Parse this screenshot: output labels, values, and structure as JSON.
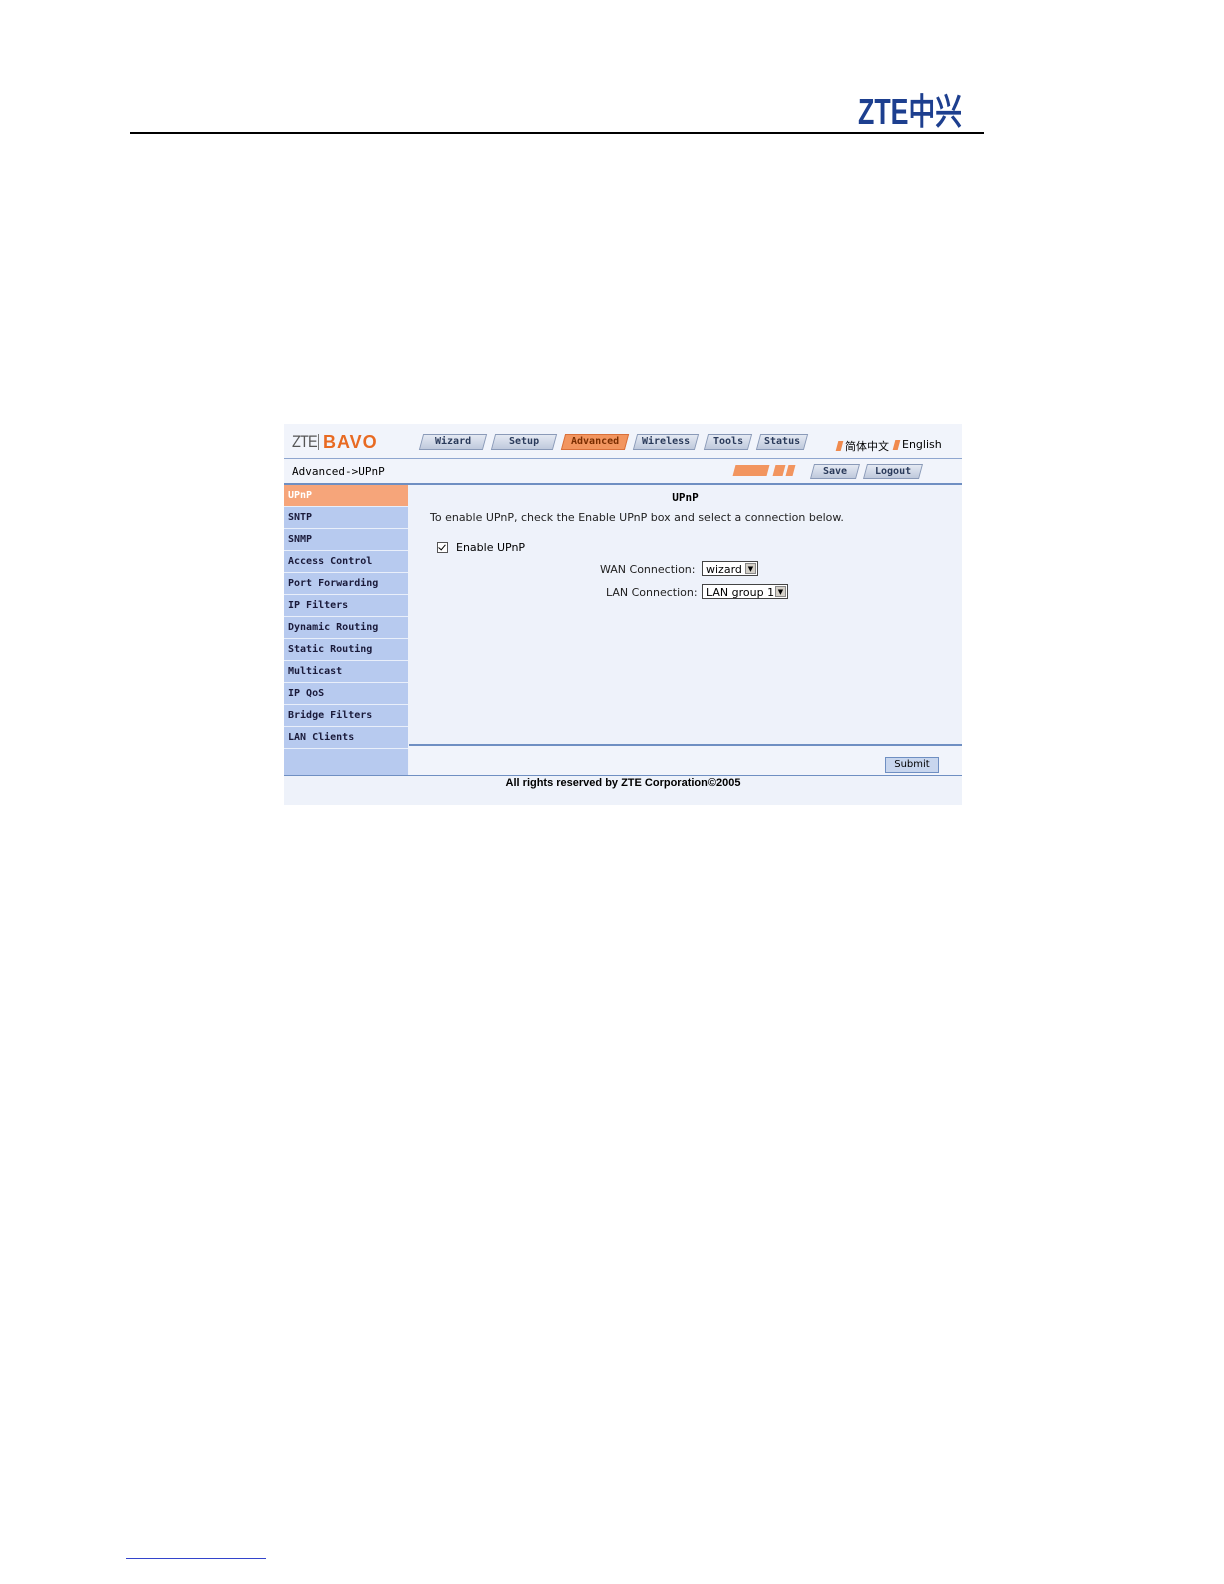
{
  "doc": {
    "logo_text": "ZTE中兴"
  },
  "ui": {
    "brand": {
      "left": "ZTE",
      "right": "BAVO"
    },
    "tabs": [
      {
        "label": "Wizard"
      },
      {
        "label": "Setup"
      },
      {
        "label": "Advanced"
      },
      {
        "label": "Wireless"
      },
      {
        "label": "Tools"
      },
      {
        "label": "Status"
      }
    ],
    "languages": [
      {
        "label": "简体中文"
      },
      {
        "label": "English"
      }
    ],
    "breadcrumb": "Advanced->UPnP",
    "actions": {
      "save": "Save",
      "logout": "Logout"
    },
    "sidebar": [
      {
        "label": "UPnP"
      },
      {
        "label": "SNTP"
      },
      {
        "label": "SNMP"
      },
      {
        "label": "Access Control"
      },
      {
        "label": "Port Forwarding"
      },
      {
        "label": "IP Filters"
      },
      {
        "label": "Dynamic Routing"
      },
      {
        "label": "Static Routing"
      },
      {
        "label": "Multicast"
      },
      {
        "label": "IP QoS"
      },
      {
        "label": "Bridge Filters"
      },
      {
        "label": "LAN Clients"
      }
    ],
    "content": {
      "title": "UPnP",
      "description": "To enable UPnP, check the Enable UPnP box and select a connection below.",
      "enable_label": "Enable UPnP",
      "enable_checked": true,
      "wan_label": "WAN Connection:",
      "wan_value": "wizard",
      "lan_label": "LAN Connection:",
      "lan_value": "LAN group 1",
      "submit": "Submit"
    },
    "footer": "All rights reserved by ZTE Corporation©2005",
    "colors": {
      "accent": "#f2955f",
      "sidebar": "#b7caef",
      "border": "#6f8fc2"
    }
  }
}
